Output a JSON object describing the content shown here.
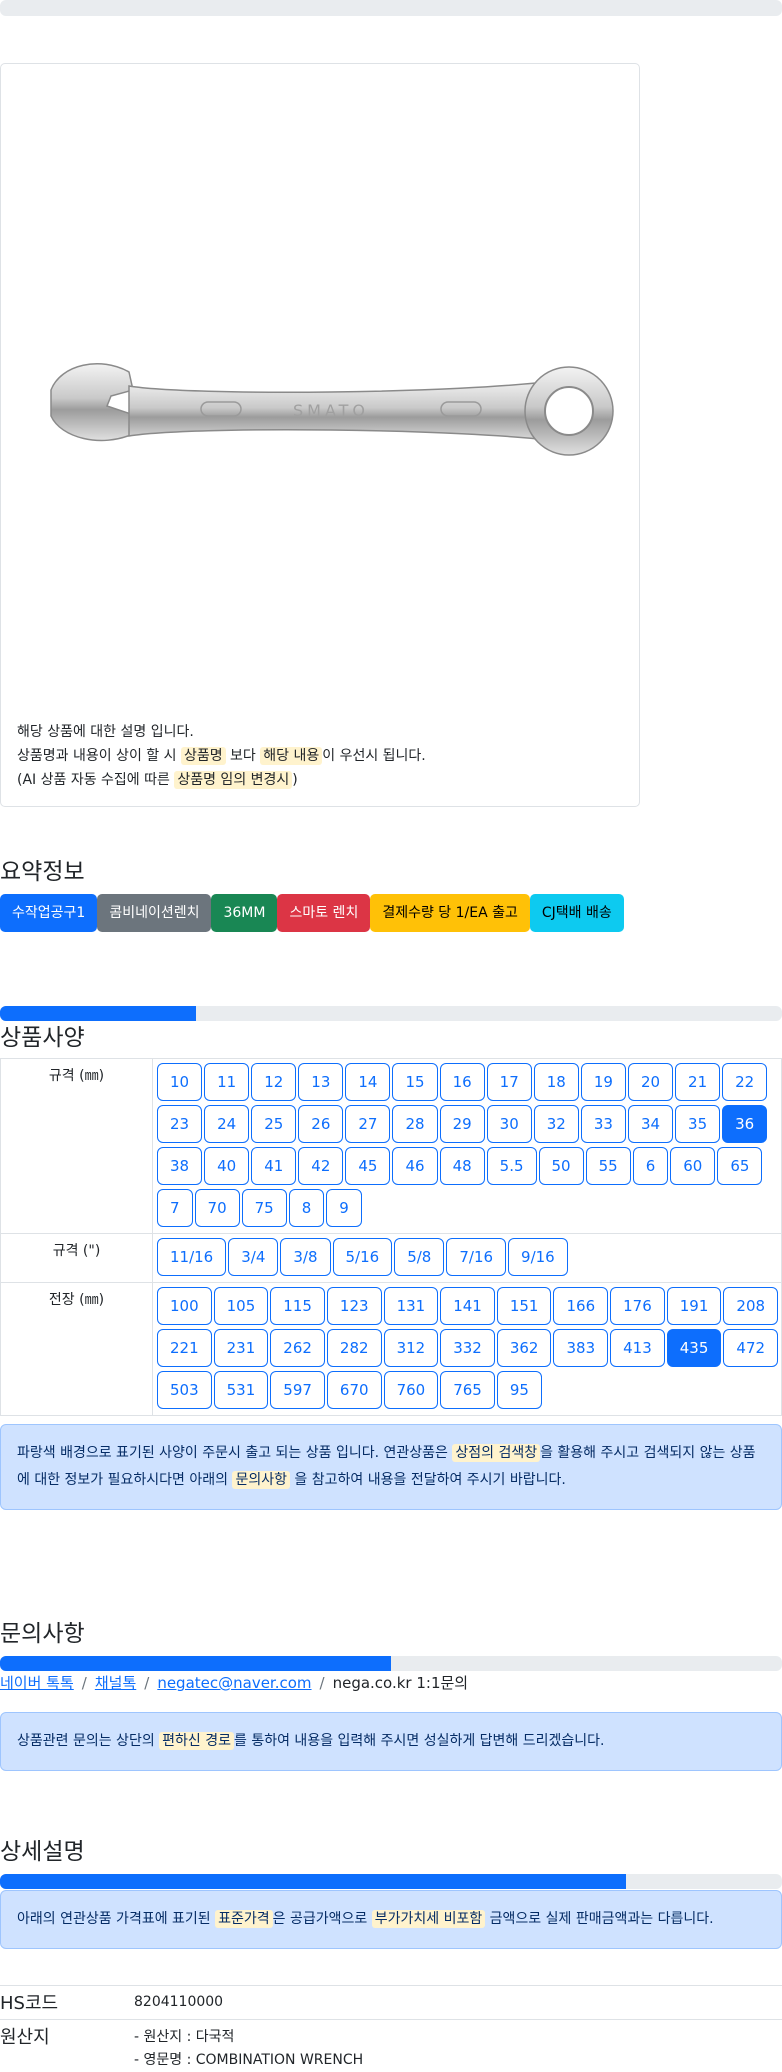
{
  "image_card": {
    "wrench_mark": "SMATO",
    "desc_line1": "해당 상품에 대한 설명 입니다.",
    "desc_line2_a": "상품명과 내용이 상이 할 시 ",
    "desc_line2_hl1": "상품명",
    "desc_line2_b": " 보다 ",
    "desc_line2_hl2": "해당 내용",
    "desc_line2_c": "이 우선시 됩니다.",
    "desc_line3_a": "(AI 상품 자동 수집에 따른 ",
    "desc_line3_hl": "상품명 임의 변경시",
    "desc_line3_b": ")"
  },
  "summary": {
    "title": "요약정보",
    "badges": [
      {
        "label": "수작업공구1",
        "color": "#0d6efd",
        "text_color": "#ffffff"
      },
      {
        "label": "콤비네이션렌치",
        "color": "#6c757d",
        "text_color": "#ffffff"
      },
      {
        "label": "36MM",
        "color": "#198754",
        "text_color": "#ffffff"
      },
      {
        "label": "스마토 렌치",
        "color": "#dc3545",
        "text_color": "#ffffff"
      },
      {
        "label": "결제수량 당 1/EA 출고",
        "color": "#ffc107",
        "text_color": "#000000"
      },
      {
        "label": "CJ택배 배송",
        "color": "#0dcaf0",
        "text_color": "#000000"
      }
    ]
  },
  "spec": {
    "title": "상품사양",
    "progress_fraction": 0.25,
    "rows": [
      {
        "label": "규격 (㎜)",
        "options": [
          "10",
          "11",
          "12",
          "13",
          "14",
          "15",
          "16",
          "17",
          "18",
          "19",
          "20",
          "21",
          "22",
          "23",
          "24",
          "25",
          "26",
          "27",
          "28",
          "29",
          "30",
          "32",
          "33",
          "34",
          "35",
          "36",
          "38",
          "40",
          "41",
          "42",
          "45",
          "46",
          "48",
          "5.5",
          "50",
          "55",
          "6",
          "60",
          "65",
          "7",
          "70",
          "75",
          "8",
          "9"
        ],
        "active": "36"
      },
      {
        "label": "규격 (\")",
        "options": [
          "11/16",
          "3/4",
          "3/8",
          "5/16",
          "5/8",
          "7/16",
          "9/16"
        ],
        "active": ""
      },
      {
        "label": "전장 (㎜)",
        "options": [
          "100",
          "105",
          "115",
          "123",
          "131",
          "141",
          "151",
          "166",
          "176",
          "191",
          "208",
          "221",
          "231",
          "262",
          "282",
          "312",
          "332",
          "362",
          "383",
          "413",
          "435",
          "472",
          "503",
          "531",
          "597",
          "670",
          "760",
          "765",
          "95"
        ],
        "active": "435"
      }
    ],
    "notice_a": "파랑색 배경으로 표기된 사양이 주문시 출고 되는 상품 입니다. 연관상품은 ",
    "notice_hl1": "상점의 검색창",
    "notice_b": "을 활용해 주시고 검색되지 않는 상품에 대한 정보가 필요하시다면 아래의 ",
    "notice_hl2": "문의사항",
    "notice_c": " 을 참고하여 내용을 전달하여 주시기 바랍니다."
  },
  "inquiry": {
    "title": "문의사항",
    "progress_fraction": 0.5,
    "links": [
      "네이버 톡톡",
      "채널톡",
      "negatec@naver.com"
    ],
    "plain": "nega.co.kr 1:1문의",
    "notice_a": "상품관련 문의는 상단의 ",
    "notice_hl": "편하신 경로",
    "notice_b": "를 통하여 내용을 입력해 주시면 성실하게 답변해 드리겠습니다."
  },
  "detail": {
    "title": "상세설명",
    "progress_fraction": 0.8,
    "notice_a": "아래의 연관상품 가격표에 표기된 ",
    "notice_hl1": "표준가격",
    "notice_b": "은 공급가액으로 ",
    "notice_hl2": "부가가치세 비포함",
    "notice_c": " 금액으로 실제 판매금액과는 다릅니다.",
    "hs_label": "HS코드",
    "hs_value": "8204110000",
    "origin_label": "원산지",
    "origin_line1": "- 원산지 : 다국적",
    "origin_line2": "- 영문명 : COMBINATION WRENCH"
  }
}
